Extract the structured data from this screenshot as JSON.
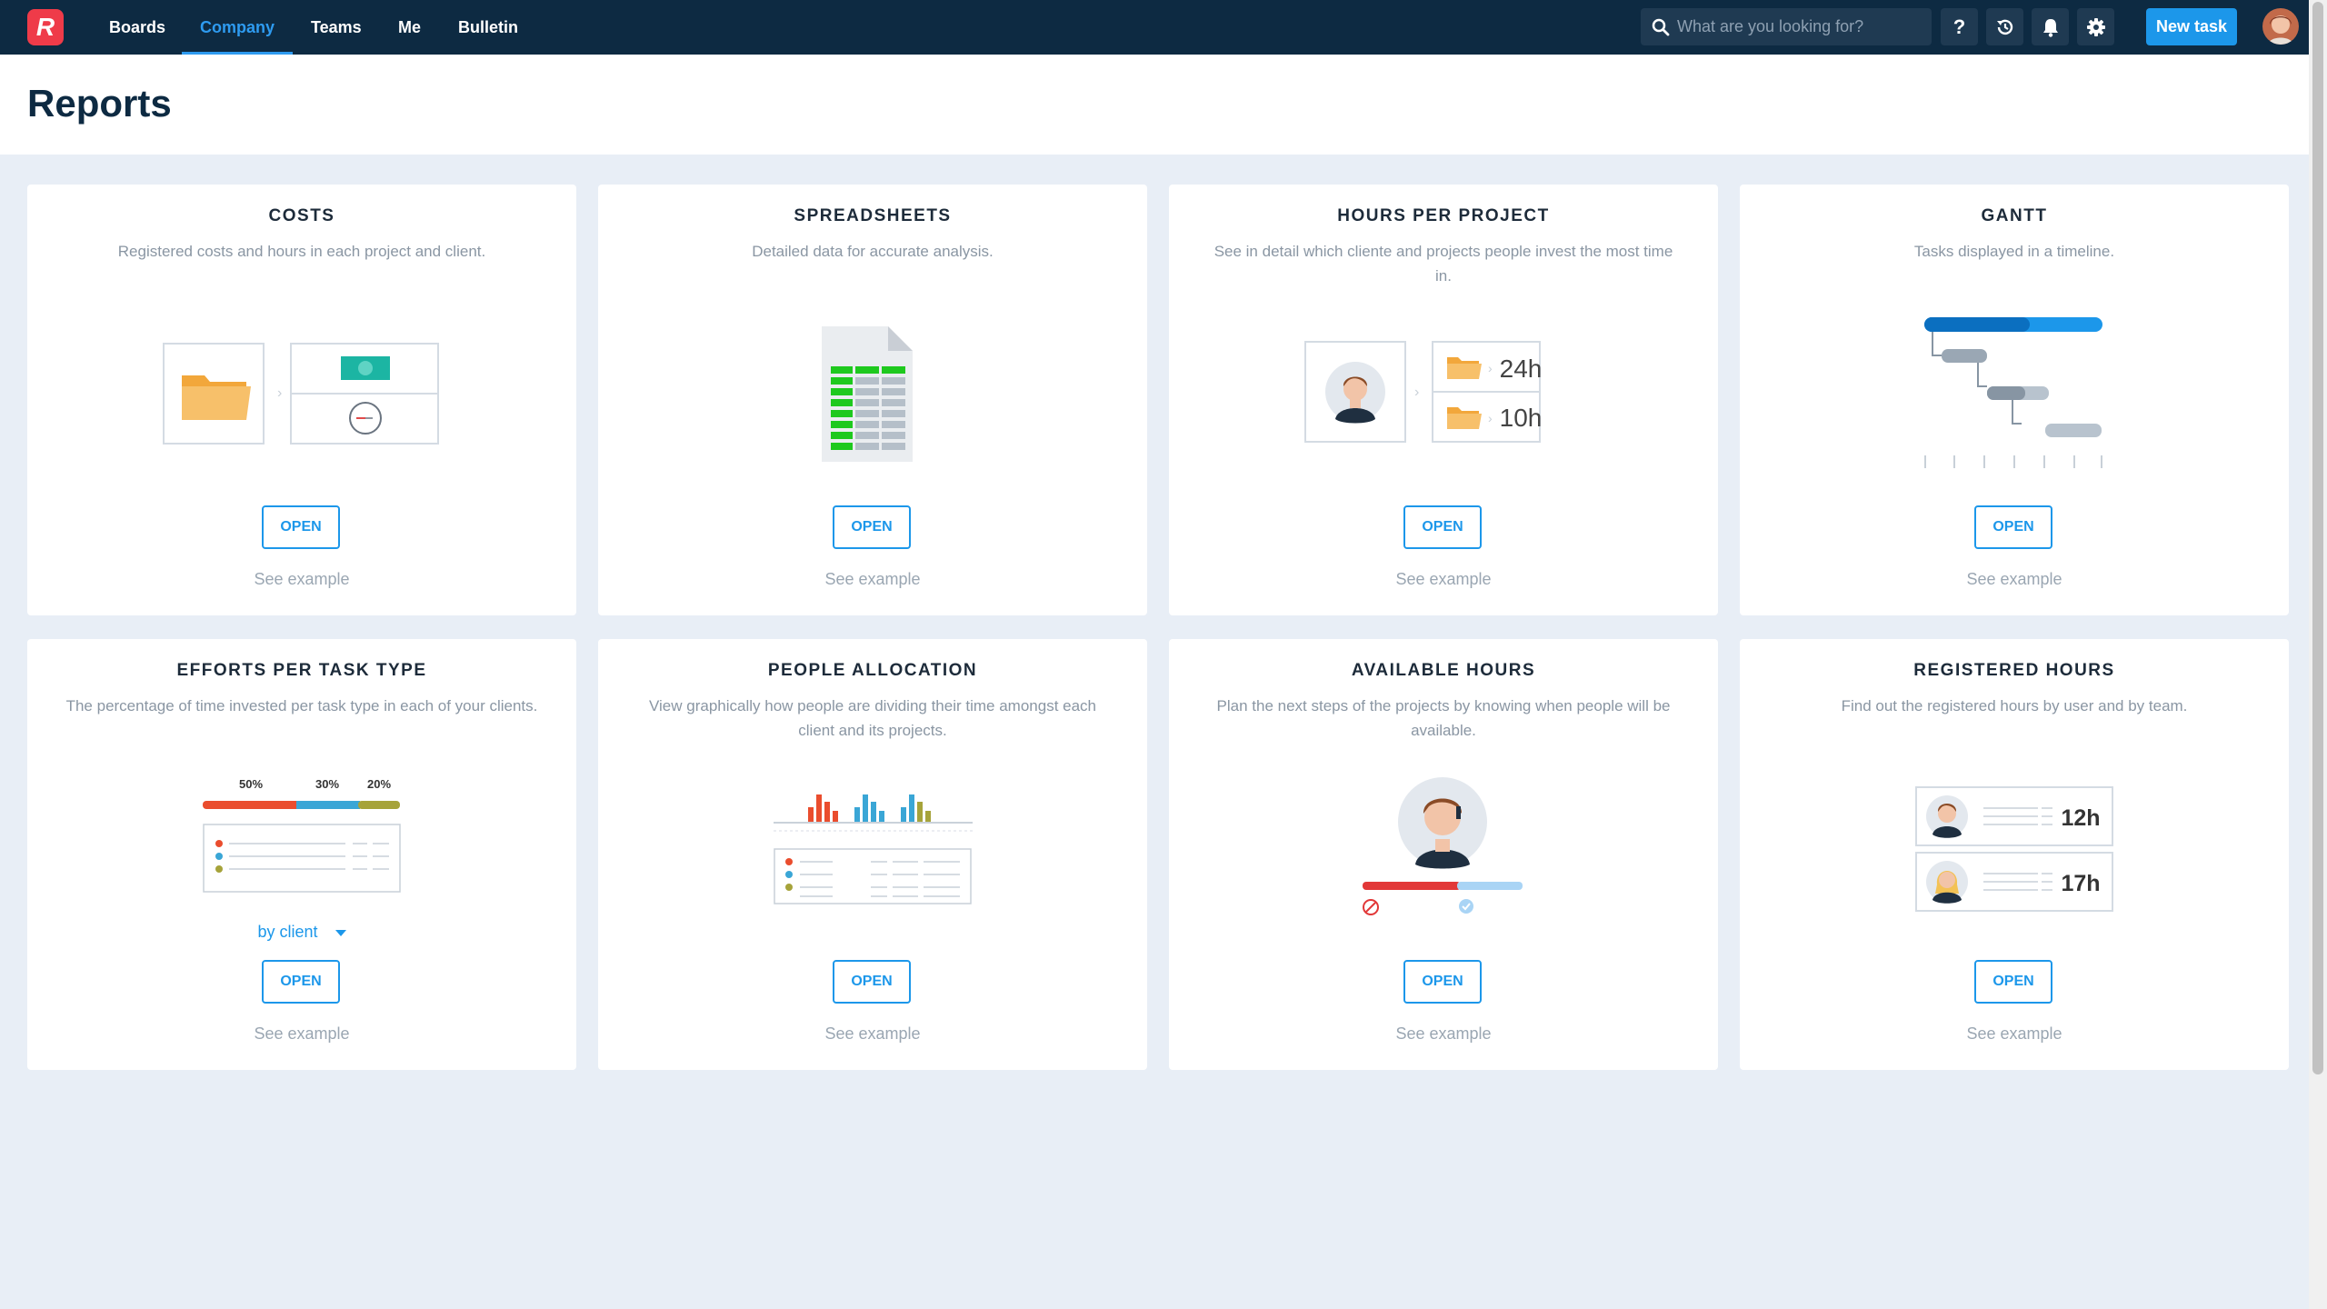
{
  "nav": {
    "logo": "R",
    "items": [
      {
        "label": "Boards"
      },
      {
        "label": "Company"
      },
      {
        "label": "Teams"
      },
      {
        "label": "Me"
      },
      {
        "label": "Bulletin"
      }
    ],
    "active": "Company",
    "search_placeholder": "What are you looking for?",
    "help_label": "?",
    "new_task_label": "New task",
    "icons": [
      "search-icon",
      "help-icon",
      "history-icon",
      "bell-icon",
      "gear-icon",
      "avatar"
    ]
  },
  "page": {
    "title": "Reports"
  },
  "cards": [
    {
      "title": "COSTS",
      "desc": "Registered costs and hours in each project and client.",
      "open": "OPEN",
      "example": "See example"
    },
    {
      "title": "SPREADSHEETS",
      "desc": "Detailed data for accurate analysis.",
      "open": "OPEN",
      "example": "See example"
    },
    {
      "title": "HOURS PER PROJECT",
      "desc": "See in detail which cliente and projects people invest the most time in.",
      "open": "OPEN",
      "example": "See example",
      "values": [
        "24h",
        "10h"
      ]
    },
    {
      "title": "GANTT",
      "desc": "Tasks displayed in a timeline.",
      "open": "OPEN",
      "example": "See example"
    },
    {
      "title": "EFFORTS PER TASK TYPE",
      "desc": "The percentage of time invested per task type in each of your clients.",
      "open": "OPEN",
      "example": "See example",
      "percents": [
        "50%",
        "30%",
        "20%"
      ],
      "dropdown": "by client"
    },
    {
      "title": "PEOPLE ALLOCATION",
      "desc": "View graphically how people are dividing their time amongst each client and its projects.",
      "open": "OPEN",
      "example": "See example"
    },
    {
      "title": "AVAILABLE HOURS",
      "desc": "Plan the next steps of the projects by knowing when people will be available.",
      "open": "OPEN",
      "example": "See example"
    },
    {
      "title": "REGISTERED HOURS",
      "desc": "Find out the registered hours by user and by team.",
      "open": "OPEN",
      "example": "See example",
      "values": [
        "12h",
        "17h"
      ]
    }
  ],
  "colors": {
    "topbar": "#0d2a42",
    "accent": "#1c97ea",
    "logo": "#ef3b49",
    "background": "#e8eef6"
  }
}
